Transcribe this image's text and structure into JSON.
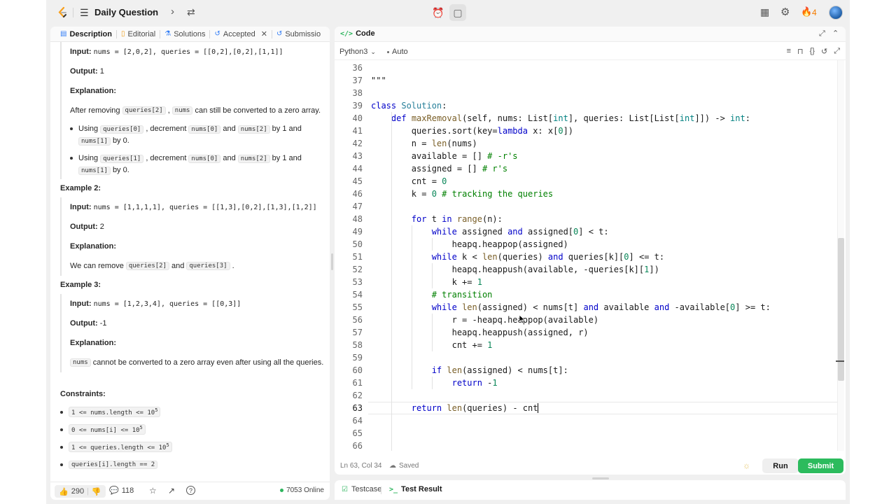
{
  "topnav": {
    "title": "Daily Question",
    "streak": "4"
  },
  "left_tabs": [
    {
      "label": "Description",
      "icon": "document-icon"
    },
    {
      "label": "Editorial",
      "icon": "book-icon"
    },
    {
      "label": "Solutions",
      "icon": "flask-icon"
    },
    {
      "label": "Accepted",
      "icon": "history-icon"
    },
    {
      "label": "Submissio",
      "icon": "history-icon"
    }
  ],
  "description": {
    "ex1": {
      "input_label": "Input:",
      "input": "nums = [2,0,2], queries = [[0,2],[0,2],[1,1]]",
      "output_label": "Output:",
      "output": "1",
      "explanation_label": "Explanation:",
      "explanation_pre": "After removing",
      "explanation_code1": "queries[2]",
      "explanation_code2": "nums",
      "explanation_post": "can still be converted to a zero array.",
      "bullets": [
        {
          "using": "Using",
          "q": "queries[0]",
          "dec": ", decrement",
          "a": "nums[0]",
          "and": "and",
          "b": "nums[2]",
          "by": "by 1 and",
          "c": "nums[1]",
          "tail": "by 0."
        },
        {
          "using": "Using",
          "q": "queries[1]",
          "dec": ", decrement",
          "a": "nums[0]",
          "and": "and",
          "b": "nums[2]",
          "by": "by 1 and",
          "c": "nums[1]",
          "tail": "by 0."
        }
      ]
    },
    "ex2": {
      "heading": "Example 2:",
      "input_label": "Input:",
      "input": "nums = [1,1,1,1], queries = [[1,3],[0,2],[1,3],[1,2]]",
      "output_label": "Output:",
      "output": "2",
      "explanation_label": "Explanation:",
      "exp_pre": "We can remove",
      "exp_code1": "queries[2]",
      "exp_and": "and",
      "exp_code2": "queries[3]",
      "exp_post": "."
    },
    "ex3": {
      "heading": "Example 3:",
      "input_label": "Input:",
      "input": "nums = [1,2,3,4], queries = [[0,3]]",
      "output_label": "Output:",
      "output": "-1",
      "explanation_label": "Explanation:",
      "exp_code": "nums",
      "exp_post": "cannot be converted to a zero array even after using all the queries."
    },
    "constraints_heading": "Constraints:",
    "constraints": [
      {
        "base": "1 <= nums.length <= 10",
        "sup": "5"
      },
      {
        "base": "0 <= nums[i] <= 10",
        "sup": "5"
      },
      {
        "base": "1 <= queries.length <= 10",
        "sup": "5"
      },
      {
        "base": "queries[i].length == 2",
        "sup": ""
      }
    ]
  },
  "left_footer": {
    "likes": "290",
    "comments": "118",
    "online": "7053 Online"
  },
  "code_panel": {
    "title": "Code",
    "language": "Python3",
    "mode": "Auto",
    "position": "Ln 63, Col 34",
    "saved": "Saved",
    "run_label": "Run",
    "submit_label": "Submit"
  },
  "code_lines": [
    {
      "n": "36",
      "html": ""
    },
    {
      "n": "37",
      "html": "\"\"\""
    },
    {
      "n": "38",
      "html": ""
    },
    {
      "n": "39",
      "html": "<span class='kw'>class</span> <span class='cl'>Solution</span>:"
    },
    {
      "n": "40",
      "html": "    <span class='kw'>def</span> <span class='fn'>maxRemoval</span>(self, nums: List[<span class='bi'>int</span>], queries: List[List[<span class='bi'>int</span>]]) -> <span class='bi'>int</span>:"
    },
    {
      "n": "41",
      "html": "        queries.sort(key=<span class='kw'>lambda</span> x: x[<span class='nm'>0</span>])"
    },
    {
      "n": "42",
      "html": "        n = <span class='fn'>len</span>(nums)"
    },
    {
      "n": "43",
      "html": "        available = [] <span class='cm'># -r's</span>"
    },
    {
      "n": "44",
      "html": "        assigned = [] <span class='cm'># r's</span>"
    },
    {
      "n": "45",
      "html": "        cnt = <span class='nm'>0</span>"
    },
    {
      "n": "46",
      "html": "        k = <span class='nm'>0</span> <span class='cm'># tracking the queries</span>"
    },
    {
      "n": "47",
      "html": ""
    },
    {
      "n": "48",
      "html": "        <span class='kw'>for</span> t <span class='kw'>in</span> <span class='fn'>range</span>(n):"
    },
    {
      "n": "49",
      "html": "            <span class='kw'>while</span> assigned <span class='kw'>and</span> assigned[<span class='nm'>0</span>] < t:"
    },
    {
      "n": "50",
      "html": "                heapq.heappop(assigned)"
    },
    {
      "n": "51",
      "html": "            <span class='kw'>while</span> k < <span class='fn'>len</span>(queries) <span class='kw'>and</span> queries[k][<span class='nm'>0</span>] <= t:"
    },
    {
      "n": "52",
      "html": "                heapq.heappush(available, -queries[k][<span class='nm'>1</span>])"
    },
    {
      "n": "53",
      "html": "                k += <span class='nm'>1</span>"
    },
    {
      "n": "54",
      "html": "            <span class='cm'># transition</span>"
    },
    {
      "n": "55",
      "html": "            <span class='kw'>while</span> <span class='fn'>len</span>(assigned) < nums[t] <span class='kw'>and</span> available <span class='kw'>and</span> -available[<span class='nm'>0</span>] >= t:"
    },
    {
      "n": "56",
      "html": "                r = -heapq.heappop(available)"
    },
    {
      "n": "57",
      "html": "                heapq.heappush(assigned, r)"
    },
    {
      "n": "58",
      "html": "                cnt += <span class='nm'>1</span>"
    },
    {
      "n": "59",
      "html": ""
    },
    {
      "n": "60",
      "html": "            <span class='kw'>if</span> <span class='fn'>len</span>(assigned) < nums[t]:"
    },
    {
      "n": "61",
      "html": "                <span class='kw'>return</span> -<span class='nm'>1</span>"
    },
    {
      "n": "62",
      "html": ""
    },
    {
      "n": "63",
      "html": "        <span class='kw'>return</span> <span class='fn'>len</span>(queries) - cnt"
    },
    {
      "n": "64",
      "html": ""
    },
    {
      "n": "65",
      "html": ""
    },
    {
      "n": "66",
      "html": ""
    }
  ],
  "test_tabs": [
    {
      "label": "Testcase"
    },
    {
      "label": "Test Result"
    }
  ],
  "colors": {
    "accent_green": "#2cbb5d",
    "streak_orange": "#f57c00",
    "keyword_blue": "#0000c9"
  }
}
